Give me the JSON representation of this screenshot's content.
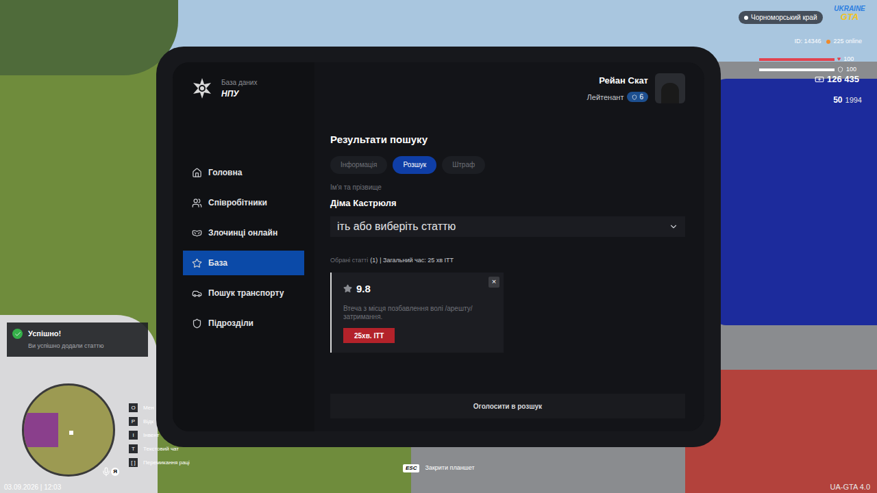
{
  "hud": {
    "location": "Чорноморський край",
    "logo": [
      "UKRAINE",
      "GTA"
    ],
    "id": "ID: 14346",
    "online": "225 online",
    "health": {
      "reading": "100",
      "level": 1.0
    },
    "armor": {
      "reading": "100",
      "level": 1.0
    },
    "money": "126 435",
    "ammo": "50",
    "ammo_total": "1994"
  },
  "tablet": {
    "header": {
      "subtitle": "База даних",
      "title": "НПУ",
      "user_name": "Рейан Скат",
      "rank": "Лейтенант",
      "rank_level": "6"
    },
    "sidebar": {
      "items": [
        {
          "label": "Головна",
          "selected": false
        },
        {
          "label": "Співробітники",
          "selected": false
        },
        {
          "label": "Злочинці онлайн",
          "selected": false
        },
        {
          "label": "База",
          "selected": true
        },
        {
          "label": "Пошук транспорту",
          "selected": false
        },
        {
          "label": "Підрозділи",
          "selected": false
        }
      ]
    },
    "content": {
      "title": "Результати пошуку",
      "tabs": [
        {
          "label": "Інформація",
          "selected": false
        },
        {
          "label": "Розшук",
          "selected": true
        },
        {
          "label": "Штраф",
          "selected": false
        }
      ],
      "name_label": "Ім'я та прізвище",
      "name": "Діма Кастрюля",
      "select": {
        "text": "іть або виберіть статтю"
      },
      "summary": {
        "label": "Обрані статті",
        "count": "(1)",
        "total": "| Загальний час: 25 хв ІТТ"
      },
      "articles": [
        {
          "code": "9.8",
          "description": "Втеча з місця позбавлення волі /арешту/затримання.",
          "time": "25хв. ІТТ",
          "remove": "×"
        }
      ],
      "submit": "Оголосити в розшук"
    }
  },
  "notification": {
    "title": "Успішно!",
    "message": "Ви успішно додали статтю"
  },
  "key_hints": [
    {
      "key": "O",
      "label": "Мен"
    },
    {
      "key": "P",
      "label": "Відк"
    },
    {
      "key": "I",
      "label": "Інвент"
    },
    {
      "key": "T",
      "label": "Текстовий чат"
    },
    {
      "key": "[ ]",
      "label": "Перемикання раці"
    }
  ],
  "mic": "Я",
  "close_hint": {
    "key": "ESC",
    "label": "Закрити планшет"
  },
  "datetime": "03.09.2026 | 12:03",
  "watermark": "UA-GTA 4.0"
}
